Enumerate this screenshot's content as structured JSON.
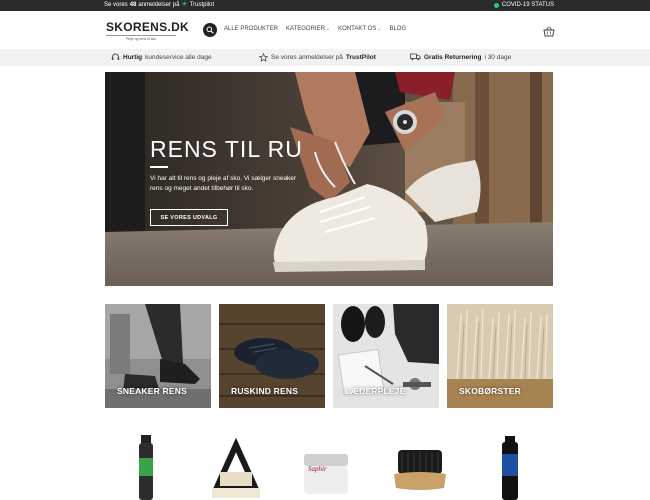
{
  "topbar": {
    "reviews_prefix": "Se vores",
    "reviews_count": "48",
    "reviews_suffix": "anmeldelser på",
    "trustpilot": "Trustpilot",
    "covid": "COVID-19 STATUS"
  },
  "header": {
    "logo": "SKORENS.DK",
    "tagline": "Pleje og rens til sko",
    "nav": [
      {
        "label": "ALLE PRODUKTER",
        "dropdown": false
      },
      {
        "label": "KATEGORIER",
        "dropdown": true
      },
      {
        "label": "KONTAKT OS",
        "dropdown": true
      },
      {
        "label": "BLOG",
        "dropdown": false
      }
    ]
  },
  "usps": [
    {
      "bold": "Hurtig",
      "text": "kundeservice alle dage",
      "icon": "headset-icon"
    },
    {
      "text": "Se vores anmeldelser på",
      "bold": "TrustPilot",
      "icon": "star-icon"
    },
    {
      "bold": "Gratis Returnering",
      "text": "i 30 dage",
      "icon": "truck-icon"
    }
  ],
  "hero": {
    "title": "RENS TIL RU",
    "text": "Vi har alt til rens og pleje af sko. Vi sælger sneaker rens og meget andet tilbehør til sko.",
    "button": "SE VORES UDVALG"
  },
  "categories": [
    {
      "label": "SNEAKER RENS"
    },
    {
      "label": "RUSKIND RENS"
    },
    {
      "label": "LÆDERPLEJE"
    },
    {
      "label": "SKOBØRSTER"
    }
  ],
  "products": {
    "saphir_label": "Saphir"
  },
  "colors": {
    "topbar": "#2b2b2b",
    "usp_bg": "#f2f2f2",
    "trustpilot_green": "#00b67a",
    "covid_dot": "#2ecc71"
  }
}
